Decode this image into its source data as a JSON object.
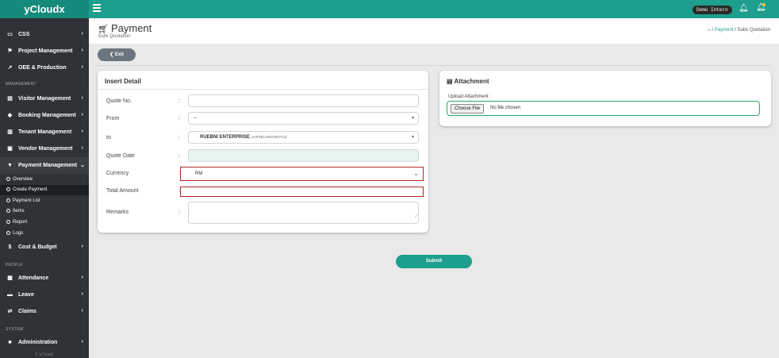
{
  "app": {
    "brand": "yCloudx",
    "demo_badge": "Demo Intern"
  },
  "sidebar": {
    "top_items": [
      {
        "label": "CSS",
        "icon": "monitor-icon"
      },
      {
        "label": "Project Management",
        "icon": "flag-icon"
      },
      {
        "label": "OEE & Production",
        "icon": "chart-line-icon"
      }
    ],
    "section_management": "MANAGEMENT",
    "management_items": [
      {
        "label": "Visitor Management",
        "icon": "id-card-icon"
      },
      {
        "label": "Booking Management",
        "icon": "tag-icon"
      },
      {
        "label": "Tenant Management",
        "icon": "building-icon"
      },
      {
        "label": "Vendor Management",
        "icon": "vendor-card-icon"
      },
      {
        "label": "Payment Management",
        "icon": "cart-icon"
      }
    ],
    "payment_sub": [
      "Overview",
      "Create Payment",
      "Payment List",
      "Items",
      "Report",
      "Logs"
    ],
    "cost_item": {
      "label": "Cost & Budget",
      "icon": "dollar-icon"
    },
    "section_people": "PEOPLE",
    "people_items": [
      {
        "label": "Attendance",
        "icon": "calendar-icon"
      },
      {
        "label": "Leave",
        "icon": "briefcase-icon"
      },
      {
        "label": "Claims",
        "icon": "exchange-icon"
      }
    ],
    "section_system": "SYSTEM",
    "system_items": [
      {
        "label": "Administration",
        "icon": "admin-icon"
      }
    ],
    "footer": "© yCloudx"
  },
  "page": {
    "title": "Payment",
    "subtitle": "Subs Quotation",
    "breadcrumb_link": "Payment",
    "breadcrumb_current": "Subs Quotation",
    "breadcrumb_sep": "/",
    "exit_label": "Exit"
  },
  "form": {
    "title": "Insert Detail",
    "labels": {
      "quote_no": "Quote No.",
      "from": "From",
      "to": "to",
      "quote_date": "Quote Date",
      "currency": "Currency",
      "total_amount": "Total Amount",
      "remarks": "Remarks"
    },
    "colon": ":",
    "values": {
      "quote_no": "",
      "from": "--",
      "to_name": "RUEBNI ENTERPRISE",
      "to_note": "(AIRSELANGOR-P14)",
      "quote_date": "",
      "currency": "RM",
      "total_amount": "",
      "remarks": ""
    }
  },
  "attachment": {
    "title": "Attachment",
    "upload_label": "Upload Attachment :",
    "choose_file": "Choose File",
    "no_file": "No file chosen"
  },
  "submit_label": "Submit"
}
